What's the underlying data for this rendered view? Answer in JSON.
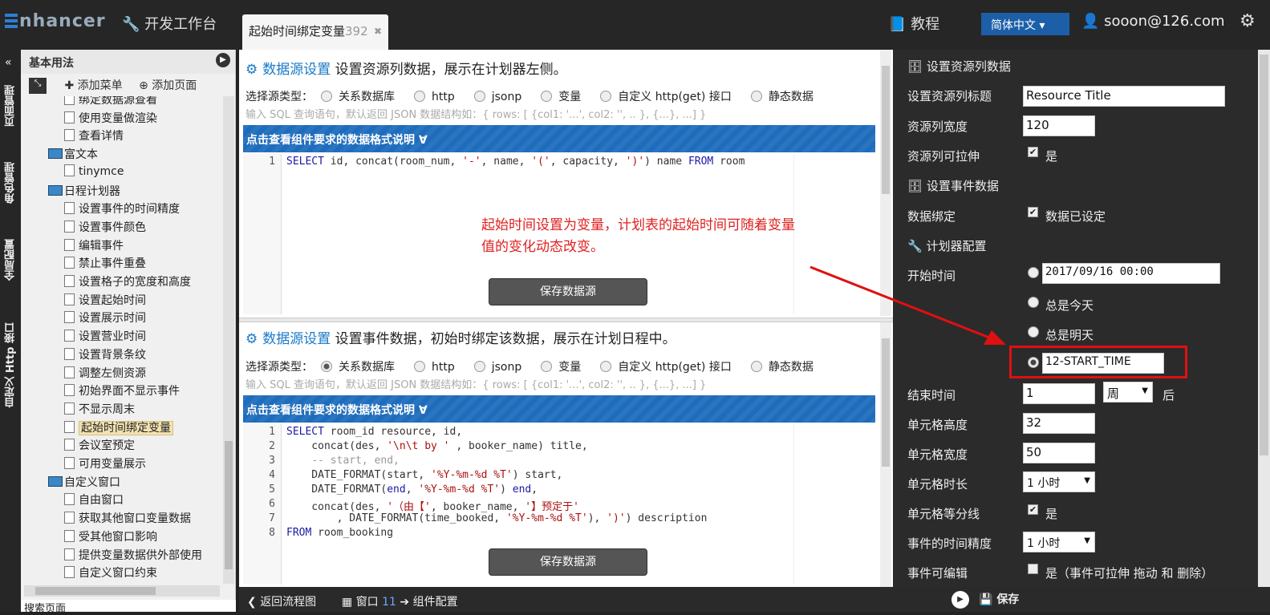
{
  "topbar": {
    "logo": "nhancer",
    "dev_workbench": "开发工作台",
    "window_tab": "起始时间绑定变量",
    "window_tab_num": "392",
    "tutorial": "教程",
    "language": "简体中文",
    "user": "sooon@126.com"
  },
  "vertical_nav": [
    "页面管理",
    "角色管理",
    "全局配置",
    "自定义 Http 接口"
  ],
  "left": {
    "title": "基本用法",
    "add_menu": "添加菜单",
    "add_page": "添加页面",
    "tree": [
      {
        "label": "绑定数据源查看",
        "type": "page",
        "indent": 2
      },
      {
        "label": "使用变量做渲染",
        "type": "page",
        "indent": 2
      },
      {
        "label": "查看详情",
        "type": "page",
        "indent": 2
      },
      {
        "label": "富文本",
        "type": "folder",
        "indent": 1
      },
      {
        "label": "tinymce",
        "type": "page",
        "indent": 2
      },
      {
        "label": "日程计划器",
        "type": "folder",
        "indent": 1
      },
      {
        "label": "设置事件的时间精度",
        "type": "page",
        "indent": 2
      },
      {
        "label": "设置事件颜色",
        "type": "page",
        "indent": 2
      },
      {
        "label": "编辑事件",
        "type": "page",
        "indent": 2
      },
      {
        "label": "禁止事件重叠",
        "type": "page",
        "indent": 2
      },
      {
        "label": "设置格子的宽度和高度",
        "type": "page",
        "indent": 2
      },
      {
        "label": "设置起始时间",
        "type": "page",
        "indent": 2
      },
      {
        "label": "设置展示时间",
        "type": "page",
        "indent": 2
      },
      {
        "label": "设置营业时间",
        "type": "page",
        "indent": 2
      },
      {
        "label": "设置背景条纹",
        "type": "page",
        "indent": 2
      },
      {
        "label": "调整左侧资源",
        "type": "page",
        "indent": 2
      },
      {
        "label": "初始界面不显示事件",
        "type": "page",
        "indent": 2
      },
      {
        "label": "不显示周末",
        "type": "page",
        "indent": 2
      },
      {
        "label": "起始时间绑定变量",
        "type": "page",
        "indent": 2,
        "selected": true
      },
      {
        "label": "会议室预定",
        "type": "page",
        "indent": 2
      },
      {
        "label": "可用变量展示",
        "type": "page",
        "indent": 2
      },
      {
        "label": "自定义窗口",
        "type": "folder",
        "indent": 1
      },
      {
        "label": "自由窗口",
        "type": "page",
        "indent": 2
      },
      {
        "label": "获取其他窗口变量数据",
        "type": "page",
        "indent": 2
      },
      {
        "label": "受其他窗口影响",
        "type": "page",
        "indent": 2
      },
      {
        "label": "提供变量数据供外部使用",
        "type": "page",
        "indent": 2
      },
      {
        "label": "自定义窗口约束",
        "type": "page",
        "indent": 2
      }
    ],
    "footer": "搜索页面"
  },
  "source_types": [
    "关系数据库",
    "http",
    "jsonp",
    "变量",
    "自定义 http(get) 接口",
    "静态数据"
  ],
  "sections": [
    {
      "title_hl": "数据源设置",
      "title_rest": "设置资源列数据，展示在计划器左侧。",
      "label_type": "选择源类型：",
      "selected": -1,
      "hint": "输入 SQL 查询语句，默认返回 JSON 数据结构如：{ rows: [ {col1: '...', col2: '', .. }, {...}, ...] }",
      "band": "点击查看组件要求的数据格式说明 ∀",
      "save": "保存数据源"
    },
    {
      "title_hl": "数据源设置",
      "title_rest": "设置事件数据，初始时绑定该数据，展示在计划日程中。",
      "label_type": "选择源类型：",
      "selected": 0,
      "hint": "输入 SQL 查询语句，默认返回 JSON 数据结构如：{ rows: [ {col1: '...', col2: '', .. }, {...}, ...] }",
      "band": "点击查看组件要求的数据格式说明 ∀",
      "save": "保存数据源"
    }
  ],
  "annotation": "起始时间设置为变量，计划表的起始时间可随着变量值的变化动态改变。",
  "bottom": {
    "back": "返回流程图",
    "window": "窗口",
    "window_num": "11",
    "arrow": "➔",
    "config": "组件配置",
    "save": "保存"
  },
  "right": {
    "res_header": "设置资源列数据",
    "res_title_label": "设置资源列标题",
    "res_title_value": "Resource Title",
    "res_width_label": "资源列宽度",
    "res_width_value": "120",
    "res_resize_label": "资源列可拉伸",
    "res_resize_text": "是",
    "evt_header": "设置事件数据",
    "bind_label": "数据绑定",
    "bind_text": "数据已设定",
    "planner_header": "计划器配置",
    "start_label": "开始时间",
    "start_value": "2017/09/16  00:00",
    "opt_today": "总是今天",
    "opt_tomorrow": "总是明天",
    "start_var": "12-START_TIME",
    "end_label": "结束时间",
    "end_value": "1",
    "end_unit": "周",
    "end_suffix": "后",
    "cell_h_label": "单元格高度",
    "cell_h_value": "32",
    "cell_w_label": "单元格宽度",
    "cell_w_value": "50",
    "cell_dur_label": "单元格时长",
    "cell_dur_value": "1 小时",
    "cell_split_label": "单元格等分线",
    "cell_split_text": "是",
    "precision_label": "事件的时间精度",
    "precision_value": "1 小时",
    "editable_label": "事件可编辑",
    "editable_text": "是（事件可拉伸 拖动 和 删除）"
  }
}
